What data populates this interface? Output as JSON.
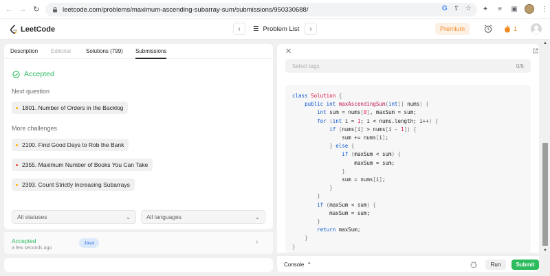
{
  "browser": {
    "url": "leetcode.com/problems/maximum-ascending-subarray-sum/submissions/950330688/"
  },
  "header": {
    "logo_text": "LeetCode",
    "problem_list_label": "Problem List",
    "premium_label": "Premium",
    "streak_count": "1",
    "colors": {
      "premium_text": "#ef8a24",
      "premium_bg": "#fdf1e6"
    }
  },
  "tabs": [
    {
      "label": "Description"
    },
    {
      "label": "Editorial"
    },
    {
      "label": "Solutions (799)"
    },
    {
      "label": "Submissions"
    }
  ],
  "result": {
    "status": "Accepted",
    "next_question_title": "Next question",
    "next_question": "1801. Number of Orders in the Backlog",
    "more_challenges_title": "More challenges",
    "challenges": [
      {
        "label": "2100. Find Good Days to Rob the Bank",
        "difficulty_color": "#ffb800"
      },
      {
        "label": "2355. Maximum Number of Books You Can Take",
        "difficulty_color": "#ef4743"
      },
      {
        "label": "2393. Count Strictly Increasing Subarrays",
        "difficulty_color": "#ffb800"
      }
    ],
    "next_question_color": "#ffb800",
    "accent_color": "#2cbb5d"
  },
  "filters": {
    "status": "All statuses",
    "language": "All languages"
  },
  "submission_row": {
    "status": "Accepted",
    "time": "a few seconds ago",
    "language": "Java"
  },
  "editor": {
    "tags_placeholder": "Select tags",
    "tags_count": "0/5"
  },
  "code_lines": [
    "class Solution {",
    "    public int maxAscendingSum(int[] nums) {",
    "        int sum = nums[0], maxSum = sum;",
    "        for (int i = 1; i < nums.length; i++) {",
    "            if (nums[i] > nums[i - 1]) {",
    "                sum += nums[i];",
    "            } else {",
    "                if (maxSum < sum) {",
    "                    maxSum = sum;",
    "                }",
    "                sum = nums[i];",
    "            }",
    "        }",
    "        if (maxSum < sum) {",
    "            maxSum = sum;",
    "        }",
    "        return maxSum;",
    "    }",
    "}"
  ],
  "footer": {
    "console_label": "Console",
    "run_label": "Run",
    "submit_label": "Submit"
  }
}
